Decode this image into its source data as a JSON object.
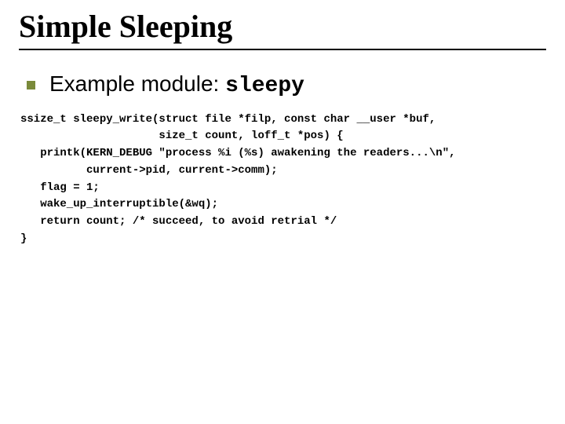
{
  "title": "Simple Sleeping",
  "bullet": {
    "prefix": "Example module: ",
    "mono": "sleepy"
  },
  "code": "ssize_t sleepy_write(struct file *filp, const char __user *buf,\n                     size_t count, loff_t *pos) {\n   printk(KERN_DEBUG \"process %i (%s) awakening the readers...\\n\",\n          current->pid, current->comm);\n   flag = 1;\n   wake_up_interruptible(&wq);\n   return count; /* succeed, to avoid retrial */\n}"
}
